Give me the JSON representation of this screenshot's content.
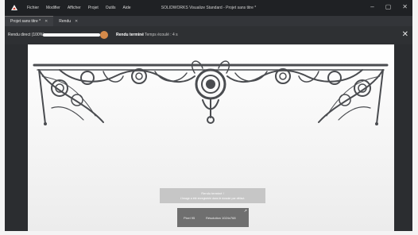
{
  "window": {
    "title": "SOLIDWORKS Visualize Standard - Projet sans titre *",
    "menu": [
      "Fichier",
      "Modifier",
      "Afficher",
      "Projet",
      "Outils",
      "Aide"
    ],
    "controls": {
      "minimize": "–",
      "maximize": "▢",
      "close": "✕"
    }
  },
  "tabs": [
    {
      "label": "Projet sans titre *",
      "close": "✕",
      "active": true
    },
    {
      "label": "Rendu",
      "close": "✕",
      "active": false
    }
  ],
  "toolbar": {
    "label": "Rendu direct (100%)",
    "slider_value": 1.0,
    "status": "Rendu terminé",
    "time": "Temps écoulé : 4 s",
    "close": "✕"
  },
  "overlay": {
    "line1": "Rendu terminé !",
    "line2": "L'image a été enregistrée dans le dossier par défaut."
  },
  "status": {
    "left": "Pixel 95",
    "right": "Résolution 1024x768",
    "corner": "↗"
  },
  "colors": {
    "accent": "#d58a4a",
    "ironwork": "#4a4c50"
  }
}
